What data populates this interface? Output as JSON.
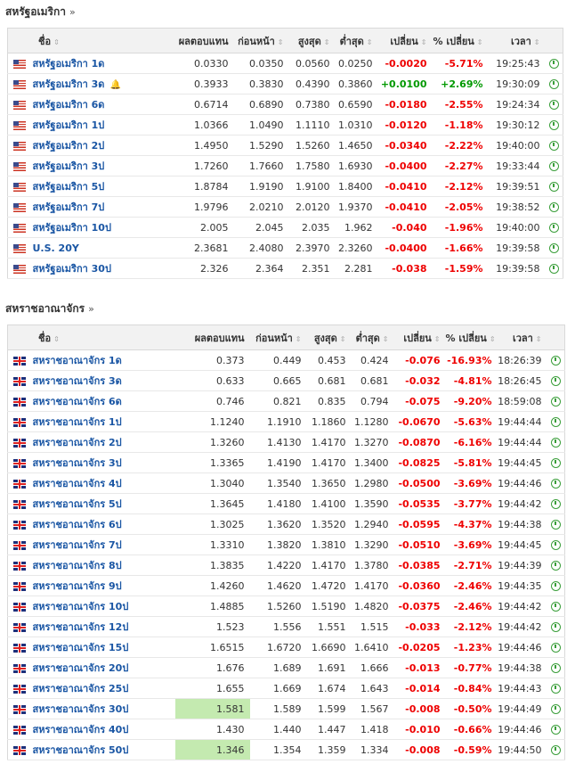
{
  "us": {
    "title": "สหรัฐอเมริกา",
    "more": "»",
    "headers": [
      "ชื่อ",
      "ผลตอบแทน",
      "ก่อนหน้า",
      "สูงสุด",
      "ต่ำสุด",
      "เปลี่ยน",
      "% เปลี่ยน",
      "เวลา"
    ],
    "sort_icon": "⇕",
    "rows": [
      {
        "name": "สหรัฐอเมริกา 1ด",
        "yield": "0.0330",
        "prev": "0.0350",
        "high": "0.0560",
        "low": "0.0250",
        "chg": "-0.0020",
        "pct": "-5.71%",
        "time": "19:25:43",
        "dir": "neg"
      },
      {
        "name": "สหรัฐอเมริกา 3ด",
        "yield": "0.3933",
        "prev": "0.3830",
        "high": "0.4390",
        "low": "0.3860",
        "chg": "+0.0100",
        "pct": "+2.69%",
        "time": "19:30:09",
        "dir": "pos",
        "bell": true
      },
      {
        "name": "สหรัฐอเมริกา 6ด",
        "yield": "0.6714",
        "prev": "0.6890",
        "high": "0.7380",
        "low": "0.6590",
        "chg": "-0.0180",
        "pct": "-2.55%",
        "time": "19:24:34",
        "dir": "neg"
      },
      {
        "name": "สหรัฐอเมริกา 1ป",
        "yield": "1.0366",
        "prev": "1.0490",
        "high": "1.1110",
        "low": "1.0310",
        "chg": "-0.0120",
        "pct": "-1.18%",
        "time": "19:30:12",
        "dir": "neg"
      },
      {
        "name": "สหรัฐอเมริกา 2ป",
        "yield": "1.4950",
        "prev": "1.5290",
        "high": "1.5260",
        "low": "1.4650",
        "chg": "-0.0340",
        "pct": "-2.22%",
        "time": "19:40:00",
        "dir": "neg"
      },
      {
        "name": "สหรัฐอเมริกา 3ป",
        "yield": "1.7260",
        "prev": "1.7660",
        "high": "1.7580",
        "low": "1.6930",
        "chg": "-0.0400",
        "pct": "-2.27%",
        "time": "19:33:44",
        "dir": "neg"
      },
      {
        "name": "สหรัฐอเมริกา 5ป",
        "yield": "1.8784",
        "prev": "1.9190",
        "high": "1.9100",
        "low": "1.8400",
        "chg": "-0.0410",
        "pct": "-2.12%",
        "time": "19:39:51",
        "dir": "neg"
      },
      {
        "name": "สหรัฐอเมริกา 7ป",
        "yield": "1.9796",
        "prev": "2.0210",
        "high": "2.0120",
        "low": "1.9370",
        "chg": "-0.0410",
        "pct": "-2.05%",
        "time": "19:38:52",
        "dir": "neg"
      },
      {
        "name": "สหรัฐอเมริกา 10ป",
        "yield": "2.005",
        "prev": "2.045",
        "high": "2.035",
        "low": "1.962",
        "chg": "-0.040",
        "pct": "-1.96%",
        "time": "19:40:00",
        "dir": "neg"
      },
      {
        "name": "U.S. 20Y",
        "yield": "2.3681",
        "prev": "2.4080",
        "high": "2.3970",
        "low": "2.3260",
        "chg": "-0.0400",
        "pct": "-1.66%",
        "time": "19:39:58",
        "dir": "neg"
      },
      {
        "name": "สหรัฐอเมริกา 30ป",
        "yield": "2.326",
        "prev": "2.364",
        "high": "2.351",
        "low": "2.281",
        "chg": "-0.038",
        "pct": "-1.59%",
        "time": "19:39:58",
        "dir": "neg"
      }
    ]
  },
  "uk": {
    "title": "สหราชอาณาจักร",
    "more": "»",
    "headers": [
      "ชื่อ",
      "ผลตอบแทน",
      "ก่อนหน้า",
      "สูงสุด",
      "ต่ำสุด",
      "เปลี่ยน",
      "% เปลี่ยน",
      "เวลา"
    ],
    "sort_icon": "⇕",
    "rows": [
      {
        "name": "สหราชอาณาจักร 1ด",
        "yield": "0.373",
        "prev": "0.449",
        "high": "0.453",
        "low": "0.424",
        "chg": "-0.076",
        "pct": "-16.93%",
        "time": "18:26:39",
        "dir": "neg"
      },
      {
        "name": "สหราชอาณาจักร 3ด",
        "yield": "0.633",
        "prev": "0.665",
        "high": "0.681",
        "low": "0.681",
        "chg": "-0.032",
        "pct": "-4.81%",
        "time": "18:26:45",
        "dir": "neg"
      },
      {
        "name": "สหราชอาณาจักร 6ด",
        "yield": "0.746",
        "prev": "0.821",
        "high": "0.835",
        "low": "0.794",
        "chg": "-0.075",
        "pct": "-9.20%",
        "time": "18:59:08",
        "dir": "neg"
      },
      {
        "name": "สหราชอาณาจักร 1ป",
        "yield": "1.1240",
        "prev": "1.1910",
        "high": "1.1860",
        "low": "1.1280",
        "chg": "-0.0670",
        "pct": "-5.63%",
        "time": "19:44:44",
        "dir": "neg"
      },
      {
        "name": "สหราชอาณาจักร 2ป",
        "yield": "1.3260",
        "prev": "1.4130",
        "high": "1.4170",
        "low": "1.3270",
        "chg": "-0.0870",
        "pct": "-6.16%",
        "time": "19:44:44",
        "dir": "neg"
      },
      {
        "name": "สหราชอาณาจักร 3ป",
        "yield": "1.3365",
        "prev": "1.4190",
        "high": "1.4170",
        "low": "1.3400",
        "chg": "-0.0825",
        "pct": "-5.81%",
        "time": "19:44:45",
        "dir": "neg"
      },
      {
        "name": "สหราชอาณาจักร 4ป",
        "yield": "1.3040",
        "prev": "1.3540",
        "high": "1.3650",
        "low": "1.2980",
        "chg": "-0.0500",
        "pct": "-3.69%",
        "time": "19:44:46",
        "dir": "neg"
      },
      {
        "name": "สหราชอาณาจักร 5ป",
        "yield": "1.3645",
        "prev": "1.4180",
        "high": "1.4100",
        "low": "1.3590",
        "chg": "-0.0535",
        "pct": "-3.77%",
        "time": "19:44:42",
        "dir": "neg"
      },
      {
        "name": "สหราชอาณาจักร 6ป",
        "yield": "1.3025",
        "prev": "1.3620",
        "high": "1.3520",
        "low": "1.2940",
        "chg": "-0.0595",
        "pct": "-4.37%",
        "time": "19:44:38",
        "dir": "neg"
      },
      {
        "name": "สหราชอาณาจักร 7ป",
        "yield": "1.3310",
        "prev": "1.3820",
        "high": "1.3810",
        "low": "1.3290",
        "chg": "-0.0510",
        "pct": "-3.69%",
        "time": "19:44:45",
        "dir": "neg"
      },
      {
        "name": "สหราชอาณาจักร 8ป",
        "yield": "1.3835",
        "prev": "1.4220",
        "high": "1.4170",
        "low": "1.3780",
        "chg": "-0.0385",
        "pct": "-2.71%",
        "time": "19:44:39",
        "dir": "neg"
      },
      {
        "name": "สหราชอาณาจักร 9ป",
        "yield": "1.4260",
        "prev": "1.4620",
        "high": "1.4720",
        "low": "1.4170",
        "chg": "-0.0360",
        "pct": "-2.46%",
        "time": "19:44:35",
        "dir": "neg"
      },
      {
        "name": "สหราชอาณาจักร 10ป",
        "yield": "1.4885",
        "prev": "1.5260",
        "high": "1.5190",
        "low": "1.4820",
        "chg": "-0.0375",
        "pct": "-2.46%",
        "time": "19:44:42",
        "dir": "neg"
      },
      {
        "name": "สหราชอาณาจักร 12ป",
        "yield": "1.523",
        "prev": "1.556",
        "high": "1.551",
        "low": "1.515",
        "chg": "-0.033",
        "pct": "-2.12%",
        "time": "19:44:42",
        "dir": "neg"
      },
      {
        "name": "สหราชอาณาจักร 15ป",
        "yield": "1.6515",
        "prev": "1.6720",
        "high": "1.6690",
        "low": "1.6410",
        "chg": "-0.0205",
        "pct": "-1.23%",
        "time": "19:44:46",
        "dir": "neg"
      },
      {
        "name": "สหราชอาณาจักร 20ป",
        "yield": "1.676",
        "prev": "1.689",
        "high": "1.691",
        "low": "1.666",
        "chg": "-0.013",
        "pct": "-0.77%",
        "time": "19:44:38",
        "dir": "neg"
      },
      {
        "name": "สหราชอาณาจักร 25ป",
        "yield": "1.655",
        "prev": "1.669",
        "high": "1.674",
        "low": "1.643",
        "chg": "-0.014",
        "pct": "-0.84%",
        "time": "19:44:43",
        "dir": "neg"
      },
      {
        "name": "สหราชอาณาจักร 30ป",
        "yield": "1.581",
        "prev": "1.589",
        "high": "1.599",
        "low": "1.567",
        "chg": "-0.008",
        "pct": "-0.50%",
        "time": "19:44:49",
        "dir": "neg",
        "highlight": true
      },
      {
        "name": "สหราชอาณาจักร 40ป",
        "yield": "1.430",
        "prev": "1.440",
        "high": "1.447",
        "low": "1.418",
        "chg": "-0.010",
        "pct": "-0.66%",
        "time": "19:44:46",
        "dir": "neg"
      },
      {
        "name": "สหราชอาณาจักร 50ป",
        "yield": "1.346",
        "prev": "1.354",
        "high": "1.359",
        "low": "1.334",
        "chg": "-0.008",
        "pct": "-0.59%",
        "time": "19:44:50",
        "dir": "neg",
        "highlight": true
      }
    ]
  },
  "colors": {
    "link": "#1a56a4",
    "negative": "#e00000",
    "positive": "#009900",
    "highlight": "#c4eab0",
    "header_bg": "#f2f2f2"
  },
  "icons": {
    "us_flag": "us-flag-icon",
    "uk_flag": "uk-flag-icon",
    "clock": "clock-icon",
    "bell": "bell-icon"
  }
}
